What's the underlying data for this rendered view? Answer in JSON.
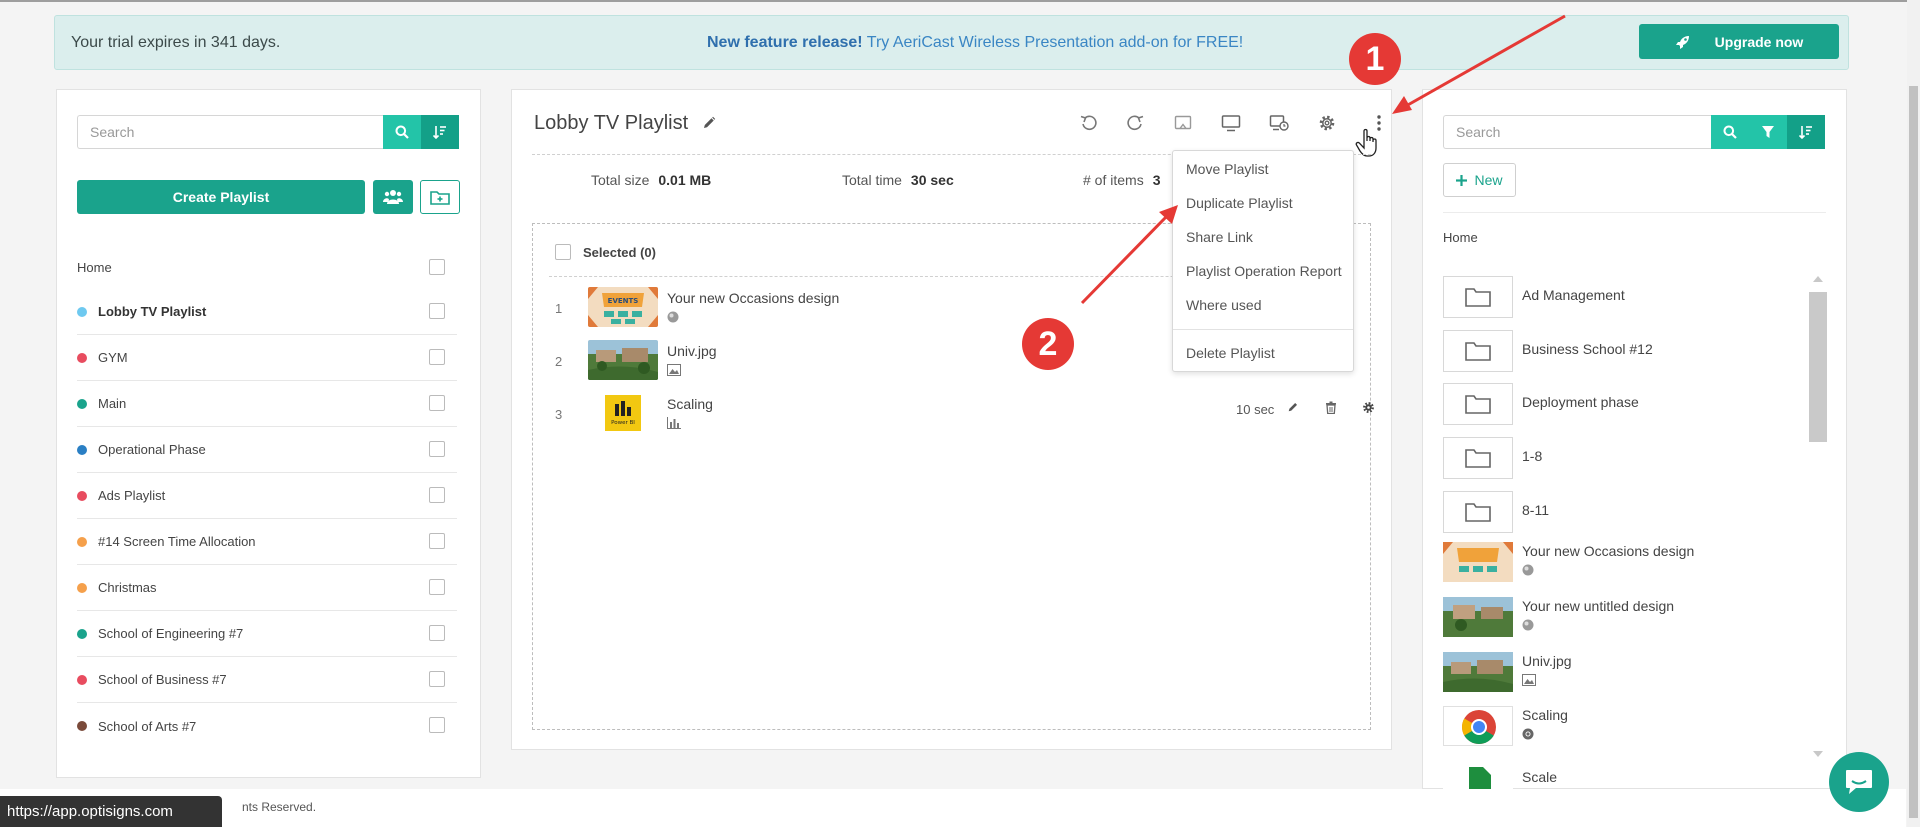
{
  "banner": {
    "trial_text": "Your trial expires in 341 days.",
    "feature_bold": "New feature release!",
    "feature_text": " Try AeriCast Wireless Presentation add-on for FREE!",
    "upgrade_label": "Upgrade now"
  },
  "left": {
    "search_placeholder": "Search",
    "create_label": "Create Playlist",
    "home_label": "Home",
    "playlists": [
      {
        "name": "Lobby TV Playlist",
        "color": "#6ec9f0",
        "active": true
      },
      {
        "name": "GYM",
        "color": "#e84c5f"
      },
      {
        "name": "Main",
        "color": "#1aa38c"
      },
      {
        "name": "Operational Phase",
        "color": "#2a7fc4"
      },
      {
        "name": "Ads Playlist",
        "color": "#e84c5f"
      },
      {
        "name": "#14 Screen Time Allocation",
        "color": "#f5a04b"
      },
      {
        "name": "Christmas",
        "color": "#f5a04b"
      },
      {
        "name": "School of Engineering #7",
        "color": "#1aa38c"
      },
      {
        "name": "School of Business #7",
        "color": "#e84c5f"
      },
      {
        "name": "School of Arts #7",
        "color": "#7a4a3a"
      }
    ]
  },
  "playlist": {
    "title": "Lobby TV Playlist",
    "total_size_label": "Total size",
    "total_size": "0.01 MB",
    "total_time_label": "Total time",
    "total_time": "30 sec",
    "items_label": "# of items",
    "items_count": "3",
    "selected_label": "Selected (0)",
    "items": [
      {
        "num": "1",
        "name": "Your new Occasions design",
        "type_icon": "design-icon"
      },
      {
        "num": "2",
        "name": "Univ.jpg",
        "type_icon": "image-icon"
      },
      {
        "num": "3",
        "name": "Scaling",
        "type_icon": "chart-icon",
        "duration": "10 sec"
      }
    ]
  },
  "menu": {
    "items": [
      "Move Playlist",
      "Duplicate Playlist",
      "Share Link",
      "Playlist Operation Report",
      "Where used",
      "Delete Playlist"
    ]
  },
  "right": {
    "search_placeholder": "Search",
    "new_label": "New",
    "home_label": "Home",
    "folders": [
      "Ad Management",
      "Business School #12",
      "Deployment phase",
      "1-8",
      "8-11"
    ],
    "assets": [
      {
        "name": "Your new Occasions design",
        "type_icon": "design-icon"
      },
      {
        "name": "Your new untitled design",
        "type_icon": "design-icon"
      },
      {
        "name": "Univ.jpg",
        "type_icon": "image-icon"
      },
      {
        "name": "Scaling",
        "type_icon": "chrome-icon"
      },
      {
        "name": "Scale",
        "type_icon": "doc-icon"
      }
    ]
  },
  "footer": {
    "copyright_fragment": "nts Reserved.",
    "status_url": "https://app.optisigns.com"
  },
  "annotations": {
    "step1": "1",
    "step2": "2"
  },
  "colors": {
    "accent": "#1aa38c",
    "accent_light": "#23c4a8",
    "annotation": "#e53935"
  }
}
